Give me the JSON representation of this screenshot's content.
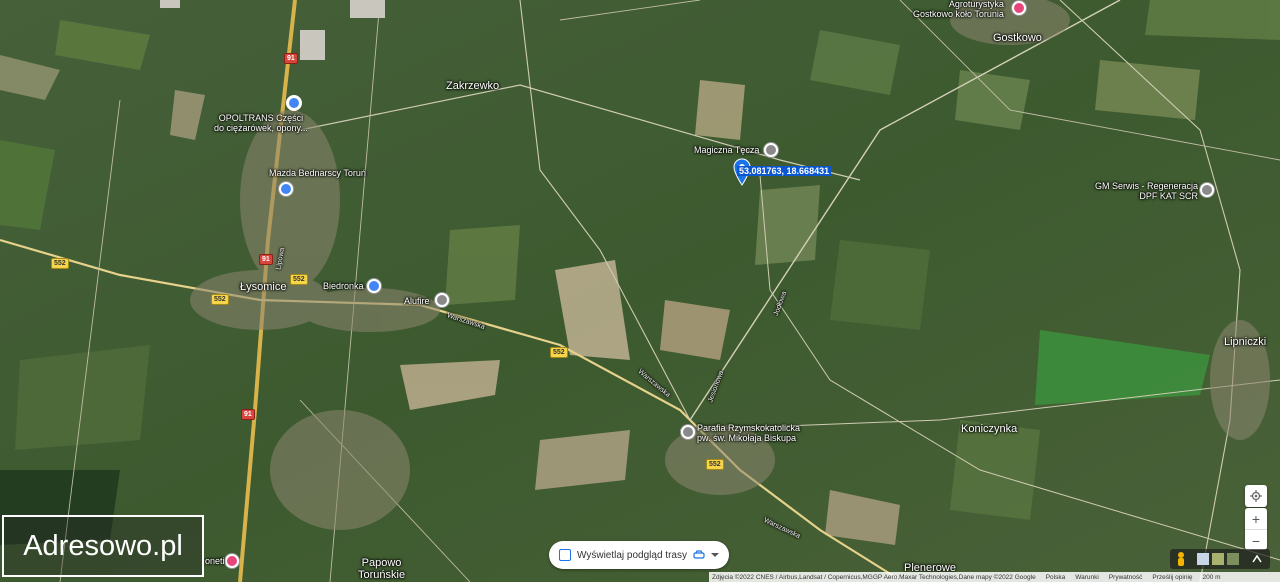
{
  "map": {
    "towns": [
      {
        "id": "zakrzewko",
        "label": "Zakrzewko"
      },
      {
        "id": "gostkowo",
        "label": "Gostkowo"
      },
      {
        "id": "lysomice",
        "label": "Łysomice"
      },
      {
        "id": "lipniczki",
        "label": "Lipniczki"
      },
      {
        "id": "koniczynka",
        "label": "Koniczynka"
      },
      {
        "id": "papowo",
        "label": "Papowo\nToruńskie"
      },
      {
        "id": "plenerowe",
        "label": "Plenerowe"
      }
    ],
    "pois": [
      {
        "id": "opoltrans",
        "label": "OPOLTRANS Części\ndo ciężarówek, opony...",
        "color": "#4285f4",
        "icon": "shop-icon"
      },
      {
        "id": "mazda",
        "label": "Mazda Bednarscy Toruń",
        "color": "#4285f4",
        "icon": "car-dealer-icon"
      },
      {
        "id": "biedronka",
        "label": "Biedronka",
        "color": "#4285f4",
        "icon": "cart-icon"
      },
      {
        "id": "alufire",
        "label": "Alufire",
        "color": "#8a8a8a",
        "icon": "place-icon"
      },
      {
        "id": "magiczna",
        "label": "Magiczna Tęcza",
        "color": "#8a8a8a",
        "icon": "place-icon"
      },
      {
        "id": "gm-serwis",
        "label": "GM Serwis - Regeneracja\nDPF KAT SCR",
        "color": "#8a8a8a",
        "icon": "place-icon"
      },
      {
        "id": "agroturystyka",
        "label": "Agroturystyka\nGostkowo koło Torunia",
        "color": "#e8457a",
        "icon": "hotel-icon"
      },
      {
        "id": "parafia",
        "label": "Parafia Rzymskokatolicka\npw. św. Mikołaja Biskupa",
        "color": "#8a8a8a",
        "icon": "church-icon"
      },
      {
        "id": "oneti",
        "label": "oneti",
        "color": "#e8457a",
        "icon": "hotel-icon"
      }
    ],
    "road_shields": [
      {
        "id": "s91a",
        "label": "91",
        "style": "red"
      },
      {
        "id": "s91b",
        "label": "91",
        "style": "red"
      },
      {
        "id": "s91c",
        "label": "91",
        "style": "red"
      },
      {
        "id": "s552a",
        "label": "552",
        "style": "yellow"
      },
      {
        "id": "s552b",
        "label": "552",
        "style": "yellow"
      },
      {
        "id": "s552c",
        "label": "552",
        "style": "yellow"
      },
      {
        "id": "s552d",
        "label": "552",
        "style": "yellow"
      },
      {
        "id": "s552e",
        "label": "552",
        "style": "yellow"
      }
    ],
    "road_names": [
      {
        "id": "warszawska1",
        "label": "Warszawska"
      },
      {
        "id": "warszawska2",
        "label": "Warszawska"
      },
      {
        "id": "warszawska3",
        "label": "Warszawska"
      },
      {
        "id": "jodlowa",
        "label": "Jodłowa"
      },
      {
        "id": "jesionowa",
        "label": "Jesionowa"
      },
      {
        "id": "lipowa",
        "label": "Lipowa"
      }
    ],
    "marker": {
      "coordinates": "53.081763, 18.668431",
      "color": "#1a73e8"
    }
  },
  "logo": {
    "text": "Adresowo.pl"
  },
  "route_preview": {
    "label": "Wyświetlaj podgląd trasy"
  },
  "controls": {
    "zoom_in": "+",
    "zoom_out": "−"
  },
  "footer": {
    "attribution": "Zdjęcia ©2022 CNES / Airbus,Landsat / Copernicus,MGGP Aero,Maxar Technologies,Dane mapy ©2022 Google",
    "language": "Polska",
    "terms": "Warunki",
    "privacy": "Prywatność",
    "feedback": "Prześlij opinię",
    "scale": "200 m"
  }
}
